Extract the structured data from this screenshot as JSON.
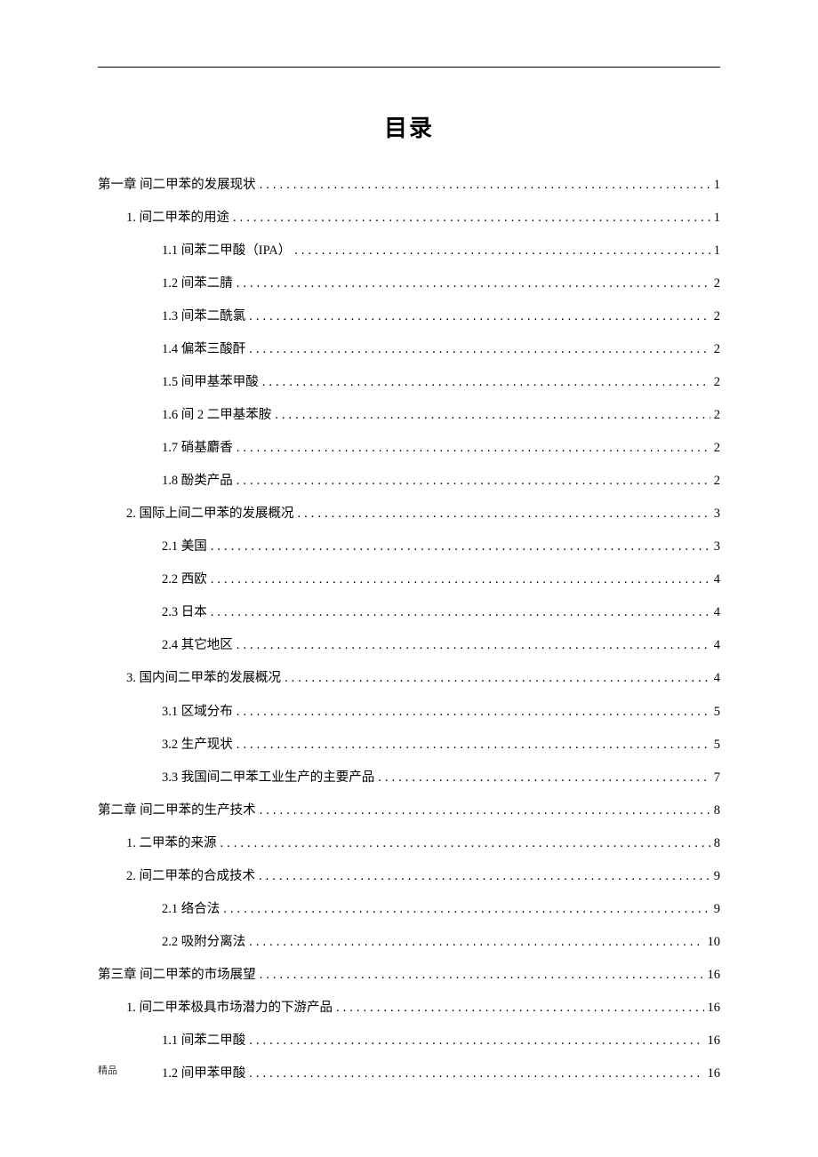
{
  "title": "目录",
  "footer": "精品",
  "toc": [
    {
      "level": 1,
      "label": "第一章  间二甲苯的发展现状",
      "page": "1"
    },
    {
      "level": 2,
      "label": "1. 间二甲苯的用途",
      "page": "1"
    },
    {
      "level": 3,
      "label": "1.1 间苯二甲酸（IPA）",
      "page": "1"
    },
    {
      "level": 3,
      "label": "1.2 间苯二腈",
      "page": "2"
    },
    {
      "level": 3,
      "label": "1.3 间苯二酰氯",
      "page": "2"
    },
    {
      "level": 3,
      "label": "1.4 偏苯三酸酐",
      "page": "2"
    },
    {
      "level": 3,
      "label": "1.5 间甲基苯甲酸",
      "page": "2"
    },
    {
      "level": 3,
      "label": "1.6 间 2 二甲基苯胺",
      "page": "2"
    },
    {
      "level": 3,
      "label": "1.7 硝基麝香",
      "page": "2"
    },
    {
      "level": 3,
      "label": "1.8 酚类产品",
      "page": "2"
    },
    {
      "level": 2,
      "label": "2. 国际上间二甲苯的发展概况",
      "page": "3"
    },
    {
      "level": 3,
      "label": "2.1 美国",
      "page": "3"
    },
    {
      "level": 3,
      "label": "2.2 西欧",
      "page": "4"
    },
    {
      "level": 3,
      "label": "2.3 日本",
      "page": "4"
    },
    {
      "level": 3,
      "label": "2.4 其它地区",
      "page": "4"
    },
    {
      "level": 2,
      "label": "3. 国内间二甲苯的发展概况",
      "page": "4"
    },
    {
      "level": 3,
      "label": "3.1 区域分布",
      "page": "5"
    },
    {
      "level": 3,
      "label": "3.2 生产现状",
      "page": "5"
    },
    {
      "level": 3,
      "label": "3.3 我国间二甲苯工业生产的主要产品",
      "page": "7"
    },
    {
      "level": 1,
      "label": "第二章  间二甲苯的生产技术",
      "page": "8"
    },
    {
      "level": 2,
      "label": "1. 二甲苯的来源",
      "page": "8"
    },
    {
      "level": 2,
      "label": "2. 间二甲苯的合成技术",
      "page": "9"
    },
    {
      "level": 3,
      "label": "2.1 络合法",
      "page": "9"
    },
    {
      "level": 3,
      "label": "2.2 吸附分离法",
      "page": "10"
    },
    {
      "level": 1,
      "label": "第三章  间二甲苯的市场展望",
      "page": "16"
    },
    {
      "level": 2,
      "label": "1. 间二甲苯极具市场潜力的下游产品",
      "page": "16"
    },
    {
      "level": 3,
      "label": "1.1 间苯二甲酸",
      "page": "16"
    },
    {
      "level": 3,
      "label": "1.2 间甲苯甲酸",
      "page": "16"
    }
  ]
}
